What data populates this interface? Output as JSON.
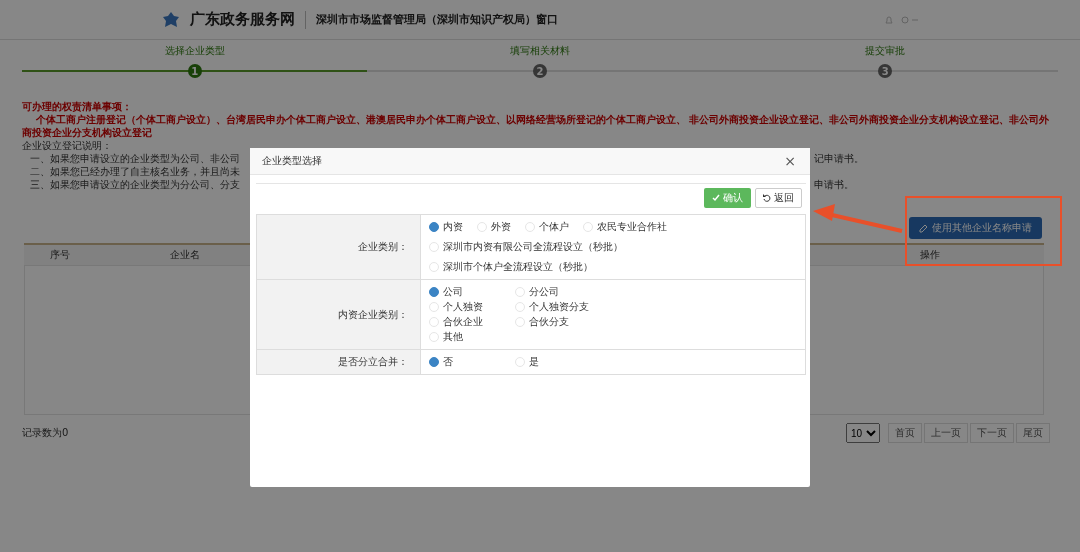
{
  "header": {
    "site_title": "广东政务服务网",
    "window_title": "深圳市市场监督管理局（深圳市知识产权局）窗口"
  },
  "steps": [
    {
      "label": "选择企业类型",
      "number": "1",
      "selected": true
    },
    {
      "label": "填写相关材料",
      "number": "2",
      "selected": false
    },
    {
      "label": "提交审批",
      "number": "3",
      "selected": false
    }
  ],
  "notice": {
    "heading": "可办理的权责清单事项：",
    "items": "个体工商户注册登记（个体工商户设立）、台湾居民申办个体工商户设立、港澳居民申办个体工商户设立、以网络经营场所登记的个体工商户设立、 非公司外商投资企业设立登记、非公司外商投资企业分支机构设立登记、非公司外商投资企业分支机构设立登记",
    "guide_title": "企业设立登记说明：",
    "guide_lines": [
      {
        "left": "一、如果您申请设立的企业类型为公司、非公司",
        "right": "记申请书。"
      },
      {
        "left": "二、如果您已经办理了自主核名业务，并且尚未"
      },
      {
        "left": "三、如果您申请设立的企业类型为分公司、分支",
        "right": "申请书。"
      }
    ]
  },
  "use_other_name_button": "使用其他企业名称申请",
  "table": {
    "columns": [
      "序号",
      "企业名",
      "操作"
    ]
  },
  "footer": {
    "record_count": "记录数为0",
    "page_size": "10",
    "pager": [
      "首页",
      "上一页",
      "下一页",
      "尾页"
    ]
  },
  "dialog": {
    "title": "企业类型选择",
    "close": "×",
    "confirm": "确认",
    "back": "返回",
    "groups": [
      {
        "label": "企业类别：",
        "options": [
          {
            "label": "内资",
            "selected": true
          },
          {
            "label": "外资",
            "selected": false
          },
          {
            "label": "个体户",
            "selected": false
          },
          {
            "label": "农民专业合作社",
            "selected": false
          }
        ],
        "extra_options": [
          {
            "label": "深圳市内资有限公司全流程设立（秒批）",
            "selected": false
          },
          {
            "label": "深圳市个体户全流程设立（秒批）",
            "selected": false
          }
        ]
      },
      {
        "label": "内资企业类别：",
        "options": [
          {
            "label": "公司",
            "selected": true
          },
          {
            "label": "分公司",
            "selected": false
          },
          {
            "label": "个人独资",
            "selected": false
          },
          {
            "label": "个人独资分支",
            "selected": false
          },
          {
            "label": "合伙企业",
            "selected": false
          },
          {
            "label": "合伙分支",
            "selected": false
          },
          {
            "label": "其他",
            "selected": false
          }
        ]
      },
      {
        "label": "是否分立合并：",
        "options": [
          {
            "label": "否",
            "selected": true
          },
          {
            "label": "是",
            "selected": false
          }
        ]
      }
    ]
  }
}
